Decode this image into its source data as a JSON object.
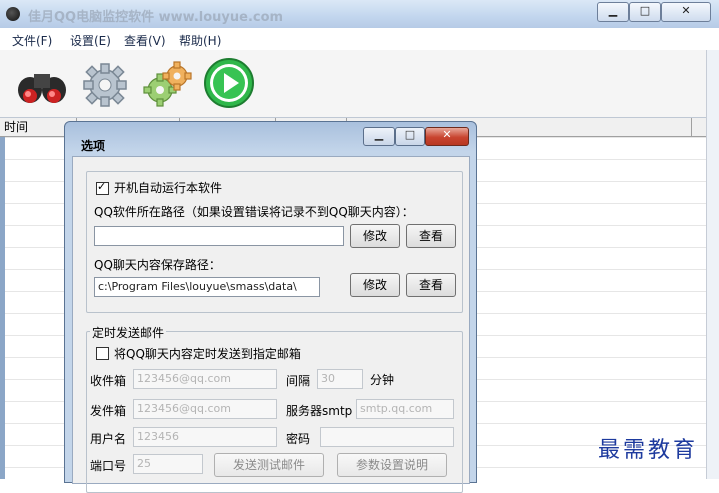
{
  "window": {
    "title": "佳月QQ电脑监控软件  www.louyue.com",
    "min_glyph": "▁",
    "max_glyph": "□",
    "close_glyph": "✕"
  },
  "menu": [
    {
      "label": "文件(F)"
    },
    {
      "label": "设置(E)"
    },
    {
      "label": "查看(V)"
    },
    {
      "label": "帮助(H)"
    }
  ],
  "toolbar": {
    "icons": [
      "binoculars-icon",
      "gear-icon",
      "gears-color-icon",
      "play-icon"
    ]
  },
  "list": {
    "columns": [
      "时间",
      "",
      "",
      "",
      ""
    ]
  },
  "dialog": {
    "title": "选项",
    "min_glyph": "▁",
    "max_glyph": "□",
    "close_glyph": "✕",
    "autostart": {
      "label": "开机自动运行本软件",
      "checked": true
    },
    "qq_path_label": "QQ软件所在路径（如果设置错误将记录不到QQ聊天内容）：",
    "qq_path_value": "",
    "save_path_label": "QQ聊天内容保存路径：",
    "save_path_value": "c:\\Program Files\\louyue\\smass\\data\\",
    "modify_label": "修改",
    "view_label": "查看",
    "email_group": {
      "legend": "定时发送邮件",
      "send_check_label": "将QQ聊天内容定时发送到指定邮箱",
      "send_checked": false,
      "inbox_label": "收件箱",
      "inbox_placeholder": "123456@qq.com",
      "interval_label": "间隔",
      "interval_value": "30",
      "interval_unit": "分钟",
      "sender_label": "发件箱",
      "sender_placeholder": "123456@qq.com",
      "smtp_label": "服务器smtp",
      "smtp_placeholder": "smtp.qq.com",
      "user_label": "用户名",
      "user_placeholder": "123456",
      "password_label": "密码",
      "port_label": "端口号",
      "port_value": "25",
      "send_test_label": "发送测试邮件",
      "params_help_label": "参数设置说明"
    }
  },
  "watermark": "最需教育"
}
